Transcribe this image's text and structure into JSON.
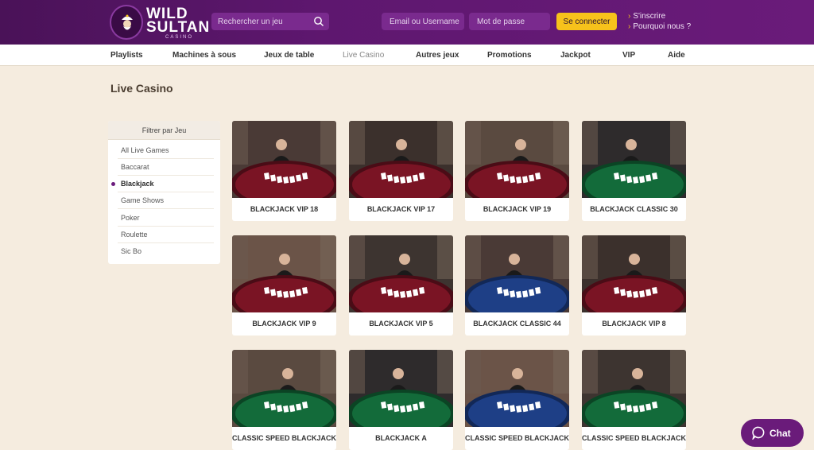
{
  "header": {
    "logo_line1": "WILD",
    "logo_line2": "SULTAN",
    "logo_line3": "CASINO",
    "search_placeholder": "Rechercher un jeu",
    "email_placeholder": "Email ou Username",
    "password_placeholder": "Mot de passe",
    "login_label": "Se connecter",
    "links": [
      {
        "label": "S'inscrire"
      },
      {
        "label": "Pourquoi nous ?"
      }
    ],
    "colors": {
      "bar": "#5e176f",
      "accent": "#f7c21b"
    }
  },
  "nav": {
    "items": [
      {
        "label": "Playlists",
        "active": false
      },
      {
        "label": "Machines à sous",
        "active": false
      },
      {
        "label": "Jeux de table",
        "active": false
      },
      {
        "label": "Live Casino",
        "active": true
      },
      {
        "label": "Autres jeux",
        "active": false
      },
      {
        "label": "Promotions",
        "active": false
      },
      {
        "label": "Jackpot",
        "active": false
      },
      {
        "label": "VIP",
        "active": false
      },
      {
        "label": "Aide",
        "active": false
      }
    ]
  },
  "page_title": "Live Casino",
  "filter": {
    "title": "Filtrer par Jeu",
    "items": [
      {
        "label": "All Live Games",
        "active": false
      },
      {
        "label": "Baccarat",
        "active": false
      },
      {
        "label": "Blackjack",
        "active": true
      },
      {
        "label": "Game Shows",
        "active": false
      },
      {
        "label": "Poker",
        "active": false
      },
      {
        "label": "Roulette",
        "active": false
      },
      {
        "label": "Sic Bo",
        "active": false
      }
    ]
  },
  "games": [
    {
      "title": "BLACKJACK VIP 18",
      "table": "red"
    },
    {
      "title": "BLACKJACK VIP 17",
      "table": "red"
    },
    {
      "title": "BLACKJACK VIP 19",
      "table": "red"
    },
    {
      "title": "BLACKJACK CLASSIC 30",
      "table": "green"
    },
    {
      "title": "BLACKJACK VIP 9",
      "table": "red"
    },
    {
      "title": "BLACKJACK VIP 5",
      "table": "red"
    },
    {
      "title": "BLACKJACK CLASSIC 44",
      "table": "blue"
    },
    {
      "title": "BLACKJACK VIP 8",
      "table": "red"
    },
    {
      "title": "CLASSIC SPEED BLACKJACK",
      "table": "green"
    },
    {
      "title": "BLACKJACK A",
      "table": "green"
    },
    {
      "title": "CLASSIC SPEED BLACKJACK",
      "table": "blue"
    },
    {
      "title": "CLASSIC SPEED BLACKJACK",
      "table": "green"
    }
  ],
  "chat": {
    "label": "Chat"
  }
}
